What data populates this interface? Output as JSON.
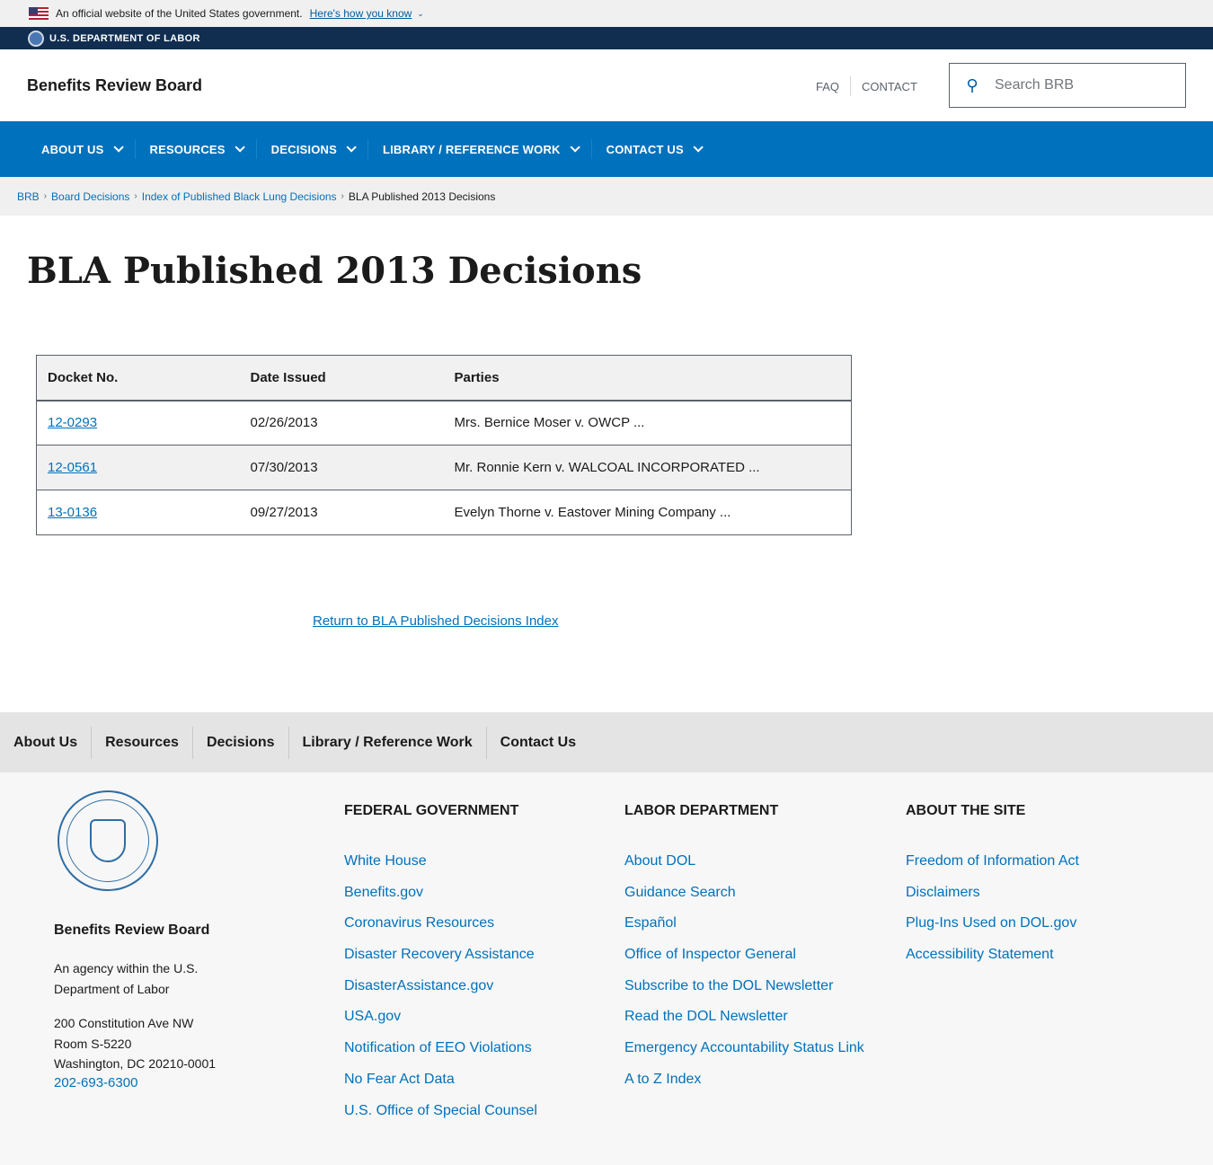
{
  "gov_banner": {
    "text": "An official website of the United States government.",
    "link": "Here's how you know"
  },
  "dol_bar": {
    "label": "U.S. DEPARTMENT OF LABOR"
  },
  "header": {
    "site_title": "Benefits Review Board",
    "faq": "FAQ",
    "contact": "CONTACT",
    "search_placeholder": "Search BRB"
  },
  "nav": [
    "ABOUT US",
    "RESOURCES",
    "DECISIONS",
    "LIBRARY / REFERENCE WORK",
    "CONTACT US"
  ],
  "breadcrumbs": [
    "BRB",
    "Board Decisions",
    "Index of Published Black Lung Decisions",
    "BLA Published 2013 Decisions"
  ],
  "page_title": "BLA Published 2013 Decisions",
  "table": {
    "headers": [
      "Docket No.",
      "Date Issued",
      "Parties"
    ],
    "rows": [
      [
        "12-0293",
        "02/26/2013",
        "Mrs. Bernice Moser v. OWCP ..."
      ],
      [
        "12-0561",
        "07/30/2013",
        "Mr. Ronnie Kern v. WALCOAL INCORPORATED ..."
      ],
      [
        "13-0136",
        "09/27/2013",
        "Evelyn Thorne v. Eastover Mining Company ..."
      ]
    ]
  },
  "return_link": "Return to BLA Published Decisions Index",
  "footer_nav": [
    "About Us",
    "Resources",
    "Decisions",
    "Library / Reference Work",
    "Contact Us"
  ],
  "footer": {
    "agency": "Benefits Review Board",
    "desc": "An agency within the U.S. Department of Labor",
    "address1": "200 Constitution Ave NW",
    "address2": "Room S-5220",
    "address3": "Washington, DC 20210-0001",
    "phone": "202-693-6300",
    "columns": [
      {
        "title": "Federal Government",
        "links": [
          "White House",
          "Benefits.gov",
          "Coronavirus Resources",
          "Disaster Recovery Assistance",
          "DisasterAssistance.gov",
          "USA.gov",
          "Notification of EEO Violations",
          "No Fear Act Data",
          "U.S. Office of Special Counsel"
        ]
      },
      {
        "title": "Labor Department",
        "links": [
          "About DOL",
          "Guidance Search",
          "Español",
          "Office of Inspector General",
          "Subscribe to the DOL Newsletter",
          "Read the DOL Newsletter",
          "Emergency Accountability Status Link",
          "A to Z Index"
        ]
      },
      {
        "title": "About the Site",
        "links": [
          "Freedom of Information Act",
          "Disclaimers",
          "Plug-Ins Used on DOL.gov",
          "Accessibility Statement"
        ]
      }
    ]
  },
  "colors": {
    "primary": "#0071bc",
    "dol_bar": "#112e51",
    "link": "#005ea2"
  }
}
